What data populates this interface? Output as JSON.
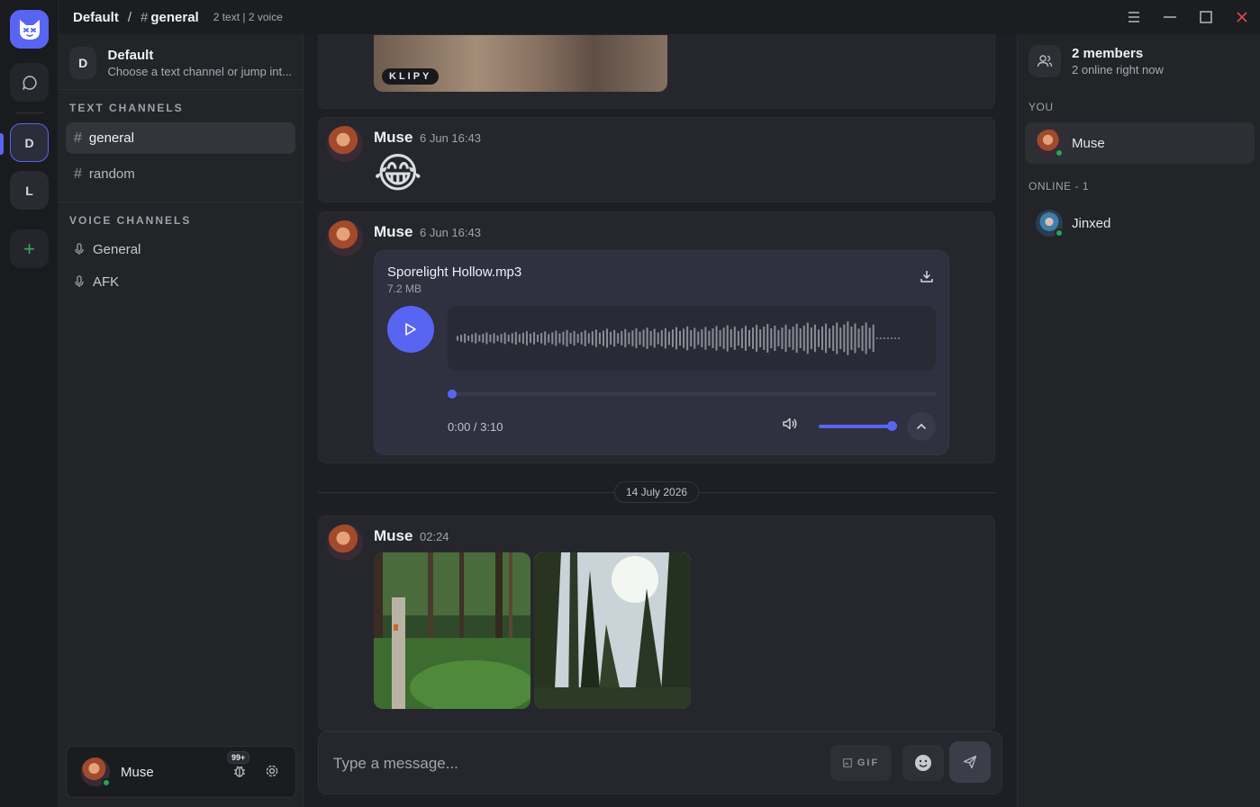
{
  "topbar": {
    "server": "Default",
    "separator": "/",
    "hash": "#",
    "channel": "general",
    "meta": "2 text | 2 voice"
  },
  "rail": {
    "servers": [
      {
        "initial": "D",
        "active": true
      },
      {
        "initial": "L",
        "active": false
      }
    ],
    "add_label": "+"
  },
  "sidebar": {
    "server_initial": "D",
    "server_name": "Default",
    "server_desc": "Choose a text channel or jump int...",
    "text_category": "TEXT CHANNELS",
    "text_channels": [
      {
        "name": "general",
        "active": true
      },
      {
        "name": "random",
        "active": false
      }
    ],
    "voice_category": "VOICE CHANNELS",
    "voice_channels": [
      "General",
      "AFK"
    ],
    "hash": "#"
  },
  "user": {
    "name": "Muse",
    "notif_badge": "99+"
  },
  "messages": {
    "gif_label": "KLIPY",
    "m1": {
      "author": "Muse",
      "time": "6 Jun 16:43",
      "emoji": "😂"
    },
    "m2": {
      "author": "Muse",
      "time": "6 Jun 16:43",
      "audio": {
        "file_name": "Sporelight Hollow.mp3",
        "file_size": "7.2 MB",
        "time_display": "0:00 / 3:10",
        "progress": 0.0,
        "volume": 1.0
      }
    },
    "date_divider": "14 July 2026",
    "m3": {
      "author": "Muse",
      "time": "02:24",
      "image_count": 2
    }
  },
  "composer": {
    "placeholder": "Type a message...",
    "gif_label": "GIF"
  },
  "members": {
    "count_label": "2 members",
    "online_label": "2 online right now",
    "you_category": "YOU",
    "self_name": "Muse",
    "online_category": "ONLINE - 1",
    "online": [
      {
        "name": "Jinxed"
      }
    ]
  },
  "colors": {
    "accent": "#5865f2",
    "online": "#23a55a",
    "close": "#e0474c",
    "bg": "#1e1f24"
  }
}
